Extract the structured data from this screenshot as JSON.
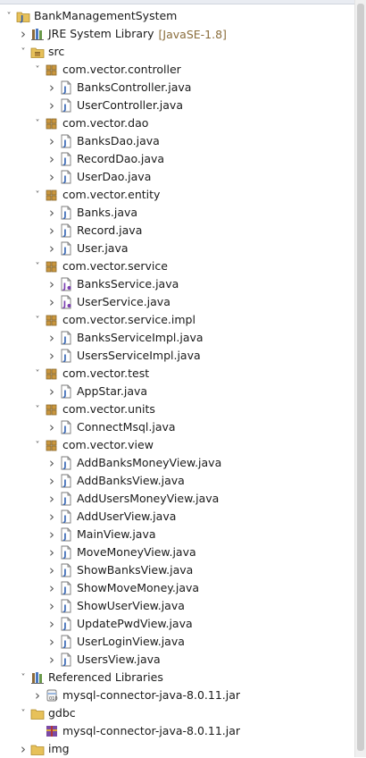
{
  "tree": [
    {
      "label": "BankManagementSystem",
      "icon": "java-project-icon",
      "expanded": true,
      "level": 0
    },
    {
      "label": "JRE System Library",
      "decoration": "[JavaSE-1.8]",
      "icon": "library-icon",
      "expanded": false,
      "level": 1
    },
    {
      "label": "src",
      "icon": "source-folder-icon",
      "expanded": true,
      "level": 1
    },
    {
      "label": "com.vector.controller",
      "icon": "package-icon",
      "expanded": true,
      "level": 2
    },
    {
      "label": "BanksController.java",
      "icon": "java-file-icon",
      "expanded": false,
      "level": 3
    },
    {
      "label": "UserController.java",
      "icon": "java-file-icon",
      "expanded": false,
      "level": 3
    },
    {
      "label": "com.vector.dao",
      "icon": "package-icon",
      "expanded": true,
      "level": 2
    },
    {
      "label": "BanksDao.java",
      "icon": "java-file-icon",
      "expanded": false,
      "level": 3
    },
    {
      "label": "RecordDao.java",
      "icon": "java-file-icon",
      "expanded": false,
      "level": 3
    },
    {
      "label": "UserDao.java",
      "icon": "java-file-icon",
      "expanded": false,
      "level": 3
    },
    {
      "label": "com.vector.entity",
      "icon": "package-icon",
      "expanded": true,
      "level": 2
    },
    {
      "label": "Banks.java",
      "icon": "java-file-icon",
      "expanded": false,
      "level": 3
    },
    {
      "label": "Record.java",
      "icon": "java-file-icon",
      "expanded": false,
      "level": 3
    },
    {
      "label": "User.java",
      "icon": "java-file-icon",
      "expanded": false,
      "level": 3
    },
    {
      "label": "com.vector.service",
      "icon": "package-icon",
      "expanded": true,
      "level": 2
    },
    {
      "label": "BanksService.java",
      "icon": "java-interface-icon",
      "expanded": false,
      "level": 3
    },
    {
      "label": "UserService.java",
      "icon": "java-interface-icon",
      "expanded": false,
      "level": 3
    },
    {
      "label": "com.vector.service.impl",
      "icon": "package-icon",
      "expanded": true,
      "level": 2
    },
    {
      "label": "BanksServiceImpl.java",
      "icon": "java-file-icon",
      "expanded": false,
      "level": 3
    },
    {
      "label": "UsersServiceImpl.java",
      "icon": "java-file-icon",
      "expanded": false,
      "level": 3
    },
    {
      "label": "com.vector.test",
      "icon": "package-icon",
      "expanded": true,
      "level": 2
    },
    {
      "label": "AppStar.java",
      "icon": "java-file-icon",
      "expanded": false,
      "level": 3
    },
    {
      "label": "com.vector.units",
      "icon": "package-icon",
      "expanded": true,
      "level": 2
    },
    {
      "label": "ConnectMsql.java",
      "icon": "java-file-icon",
      "expanded": false,
      "level": 3
    },
    {
      "label": "com.vector.view",
      "icon": "package-icon",
      "expanded": true,
      "level": 2
    },
    {
      "label": "AddBanksMoneyView.java",
      "icon": "java-file-icon",
      "expanded": false,
      "level": 3
    },
    {
      "label": "AddBanksView.java",
      "icon": "java-file-icon",
      "expanded": false,
      "level": 3
    },
    {
      "label": "AddUsersMoneyView.java",
      "icon": "java-file-icon",
      "expanded": false,
      "level": 3
    },
    {
      "label": "AddUserView.java",
      "icon": "java-file-icon",
      "expanded": false,
      "level": 3
    },
    {
      "label": "MainView.java",
      "icon": "java-file-icon",
      "expanded": false,
      "level": 3
    },
    {
      "label": "MoveMoneyView.java",
      "icon": "java-file-icon",
      "expanded": false,
      "level": 3
    },
    {
      "label": "ShowBanksView.java",
      "icon": "java-file-icon",
      "expanded": false,
      "level": 3
    },
    {
      "label": "ShowMoveMoney.java",
      "icon": "java-file-icon",
      "expanded": false,
      "level": 3
    },
    {
      "label": "ShowUserView.java",
      "icon": "java-file-icon",
      "expanded": false,
      "level": 3
    },
    {
      "label": "UpdatePwdView.java",
      "icon": "java-file-icon",
      "expanded": false,
      "level": 3
    },
    {
      "label": "UserLoginView.java",
      "icon": "java-file-icon",
      "expanded": false,
      "level": 3
    },
    {
      "label": "UsersView.java",
      "icon": "java-file-icon",
      "expanded": false,
      "level": 3
    },
    {
      "label": "Referenced Libraries",
      "icon": "library-icon",
      "expanded": true,
      "level": 1
    },
    {
      "label": "mysql-connector-java-8.0.11.jar",
      "icon": "jar-icon",
      "expanded": false,
      "level": 2
    },
    {
      "label": "gdbc",
      "icon": "folder-icon",
      "expanded": true,
      "level": 1
    },
    {
      "label": "mysql-connector-java-8.0.11.jar",
      "icon": "archive-icon",
      "expanded": null,
      "level": 2
    },
    {
      "label": "img",
      "icon": "folder-icon",
      "expanded": false,
      "level": 1
    }
  ],
  "colors": {
    "package": "#b58a3c",
    "java_file": "#3b69b6",
    "folder": "#e7c15a",
    "decoration": "#8a6d3b"
  }
}
